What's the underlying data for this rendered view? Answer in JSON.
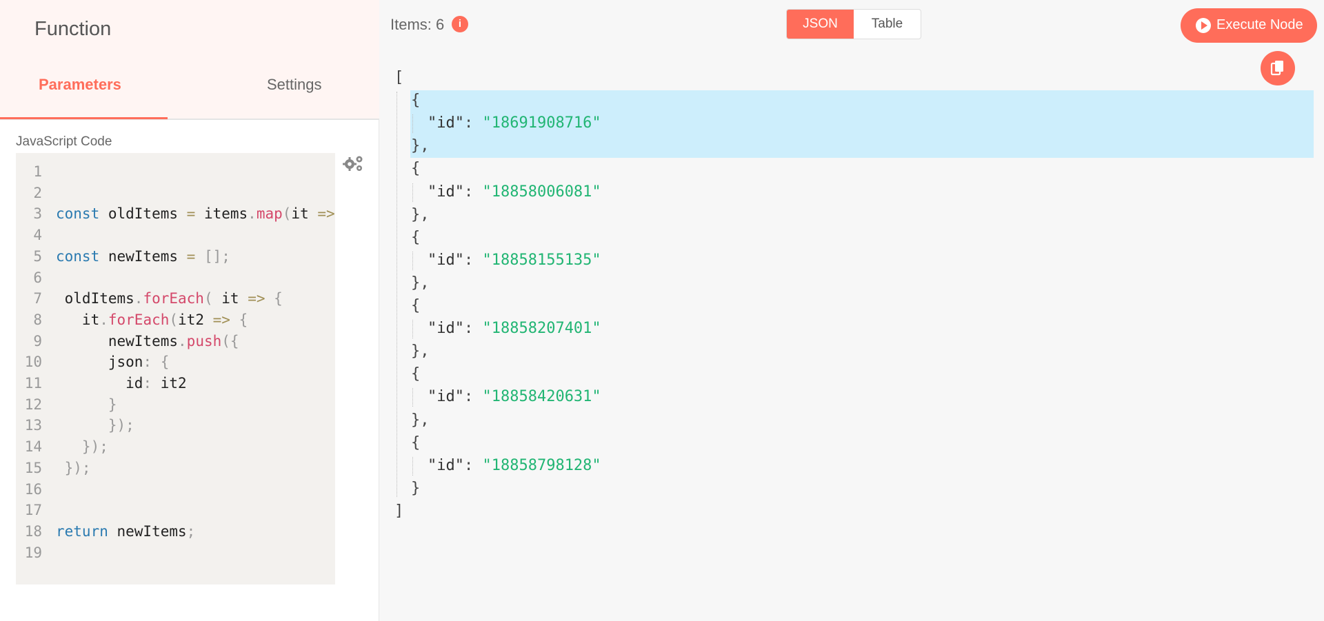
{
  "node": {
    "title": "Function",
    "tabs": [
      "Parameters",
      "Settings"
    ],
    "active_tab": "Parameters",
    "code_label": "JavaScript Code",
    "code_options_icon": "gear-icon"
  },
  "code": {
    "lines": [
      {
        "n": "1",
        "tokens": []
      },
      {
        "n": "2",
        "tokens": []
      },
      {
        "n": "3",
        "tokens": [
          [
            "kw",
            "const"
          ],
          [
            "plain",
            " oldItems "
          ],
          [
            "op",
            "="
          ],
          [
            "plain",
            " items"
          ],
          [
            "punc",
            "."
          ],
          [
            "fn",
            "map"
          ],
          [
            "punc",
            "("
          ],
          [
            "plain",
            "it "
          ],
          [
            "op",
            "=>"
          ]
        ]
      },
      {
        "n": "4",
        "tokens": []
      },
      {
        "n": "5",
        "tokens": [
          [
            "kw",
            "const"
          ],
          [
            "plain",
            " newItems "
          ],
          [
            "op",
            "="
          ],
          [
            "plain",
            " "
          ],
          [
            "punc",
            "[];"
          ]
        ]
      },
      {
        "n": "6",
        "tokens": []
      },
      {
        "n": "7",
        "tokens": [
          [
            "plain",
            " oldItems"
          ],
          [
            "punc",
            "."
          ],
          [
            "fn",
            "forEach"
          ],
          [
            "punc",
            "( "
          ],
          [
            "plain",
            "it "
          ],
          [
            "op",
            "=>"
          ],
          [
            "punc",
            " {"
          ]
        ]
      },
      {
        "n": "8",
        "tokens": [
          [
            "plain",
            "   it"
          ],
          [
            "punc",
            "."
          ],
          [
            "fn",
            "forEach"
          ],
          [
            "punc",
            "("
          ],
          [
            "plain",
            "it2 "
          ],
          [
            "op",
            "=>"
          ],
          [
            "punc",
            " {"
          ]
        ]
      },
      {
        "n": "9",
        "tokens": [
          [
            "plain",
            "      newItems"
          ],
          [
            "punc",
            "."
          ],
          [
            "fn",
            "push"
          ],
          [
            "punc",
            "({"
          ]
        ]
      },
      {
        "n": "10",
        "tokens": [
          [
            "plain",
            "      json"
          ],
          [
            "punc",
            ": {"
          ]
        ]
      },
      {
        "n": "11",
        "tokens": [
          [
            "plain",
            "        id"
          ],
          [
            "punc",
            ": "
          ],
          [
            "plain",
            "it2"
          ]
        ]
      },
      {
        "n": "12",
        "tokens": [
          [
            "punc",
            "      }"
          ]
        ]
      },
      {
        "n": "13",
        "tokens": [
          [
            "punc",
            "      });"
          ]
        ]
      },
      {
        "n": "14",
        "tokens": [
          [
            "punc",
            "   });"
          ]
        ]
      },
      {
        "n": "15",
        "tokens": [
          [
            "punc",
            " });"
          ]
        ]
      },
      {
        "n": "16",
        "tokens": []
      },
      {
        "n": "17",
        "tokens": []
      },
      {
        "n": "18",
        "tokens": [
          [
            "kw",
            "return"
          ],
          [
            "plain",
            " newItems"
          ],
          [
            "punc",
            ";"
          ]
        ]
      },
      {
        "n": "19",
        "tokens": []
      }
    ]
  },
  "output": {
    "items_label": "Items: 6",
    "info_icon": "info-icon",
    "view_modes": [
      "JSON",
      "Table"
    ],
    "active_view": "JSON",
    "execute_label": "Execute Node",
    "copy_icon": "copy-icon",
    "items": [
      {
        "key": "\"id\"",
        "value": "\"18691908716\""
      },
      {
        "key": "\"id\"",
        "value": "\"18858006081\""
      },
      {
        "key": "\"id\"",
        "value": "\"18858155135\""
      },
      {
        "key": "\"id\"",
        "value": "\"18858207401\""
      },
      {
        "key": "\"id\"",
        "value": "\"18858420631\""
      },
      {
        "key": "\"id\"",
        "value": "\"18858798128\""
      }
    ],
    "open_bracket": "[",
    "close_bracket": "]",
    "open_brace": "{",
    "close_brace_comma": "},",
    "close_brace": "}"
  },
  "colors": {
    "accent": "#ff6d5a",
    "header_bg": "#fff5f3",
    "json_string": "#21b573",
    "highlight": "#cdeefc"
  }
}
